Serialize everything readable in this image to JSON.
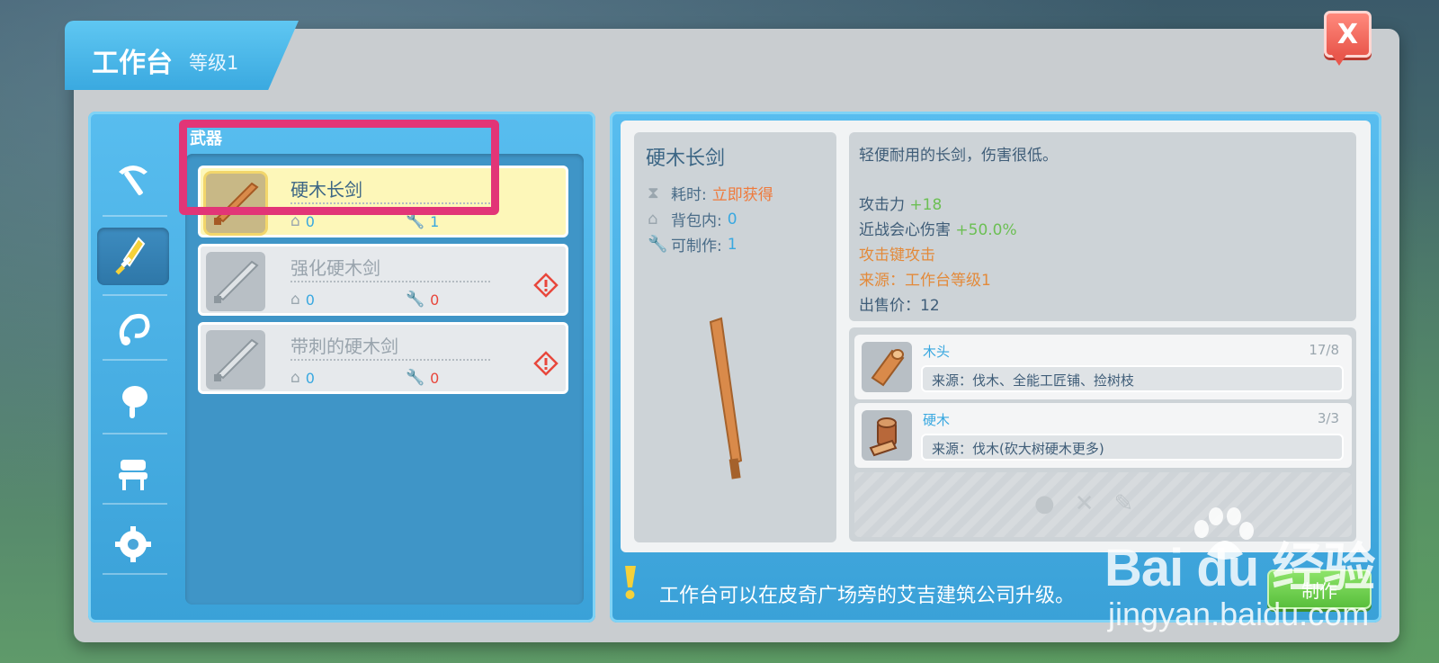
{
  "window": {
    "title": "工作台",
    "level": "等级1",
    "close_label": "X"
  },
  "categories": {
    "heading": "武器",
    "items": [
      {
        "icon": "pickaxe-icon"
      },
      {
        "icon": "weapon-icon",
        "active": true
      },
      {
        "icon": "hook-icon"
      },
      {
        "icon": "food-icon"
      },
      {
        "icon": "furniture-icon"
      },
      {
        "icon": "settings-gear-icon"
      }
    ]
  },
  "recipes": [
    {
      "name": "硬木长剑",
      "backpack": "0",
      "craftable": "1",
      "selected": true,
      "warning": false
    },
    {
      "name": "强化硬木剑",
      "backpack": "0",
      "craftable": "0",
      "selected": false,
      "warning": true
    },
    {
      "name": "带刺的硬木剑",
      "backpack": "0",
      "craftable": "0",
      "selected": false,
      "warning": true
    }
  ],
  "detail": {
    "name": "硬木长剑",
    "time_label": "耗时:",
    "time_value": "立即获得",
    "backpack_label": "背包内:",
    "backpack_value": "0",
    "craftable_label": "可制作:",
    "craftable_value": "1",
    "description": "轻便耐用的长剑，伤害很低。",
    "attack_label": "攻击力",
    "attack_value": "+18",
    "crit_label": "近战会心伤害",
    "crit_value": "+50.0%",
    "attack_key": "攻击键攻击",
    "source": "来源：工作台等级1",
    "sell_price": "出售价：12"
  },
  "materials": [
    {
      "name": "木头",
      "count": "17/8",
      "source": "来源：伐木、全能工匠铺、捡树枝"
    },
    {
      "name": "硬木",
      "count": "3/3",
      "source": "来源：伐木(砍大树硬木更多)"
    }
  ],
  "tip": "工作台可以在皮奇广场旁的艾吉建筑公司升级。",
  "craft_label": "制作",
  "watermark": {
    "brand": "Bai du 经验",
    "url": "jingyan.baidu.com"
  },
  "colors": {
    "accent": "#3aa9e0",
    "highlight": "#e23577",
    "craft": "#59bf3c",
    "close": "#e9574c"
  }
}
